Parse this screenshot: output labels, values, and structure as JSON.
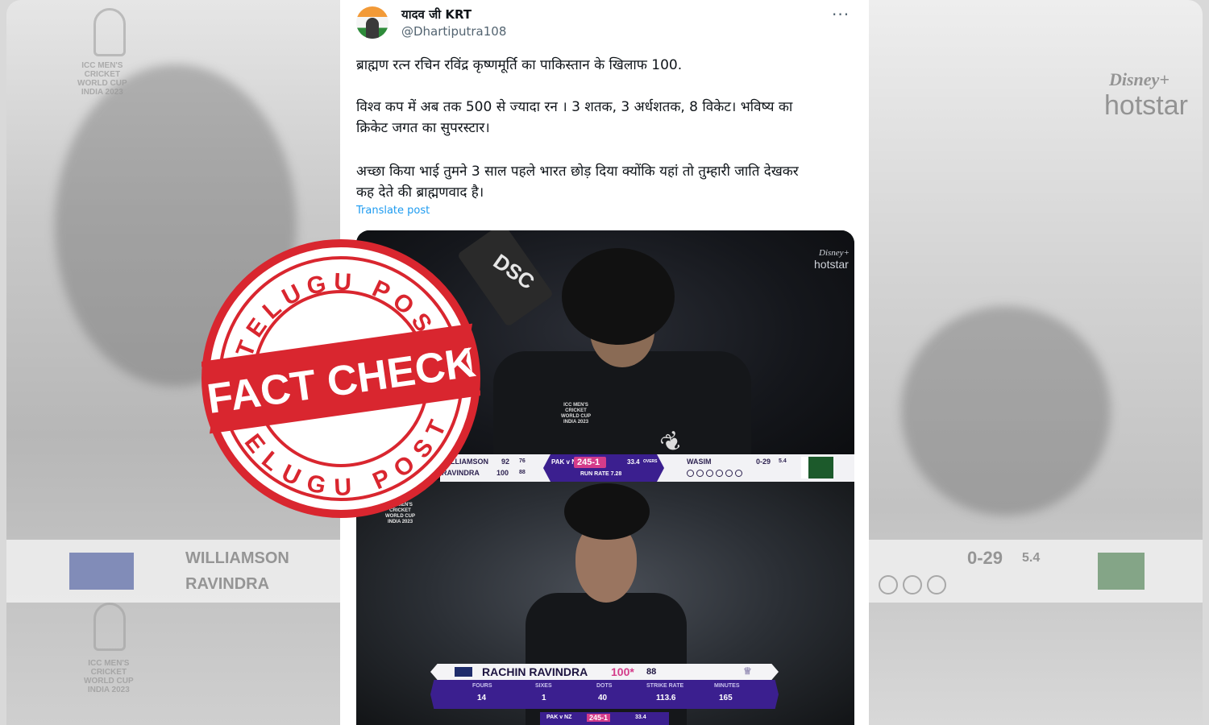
{
  "tweet": {
    "display_name": "यादव जी KRT",
    "handle": "@Dhartiputra108",
    "more_icon": "more-horizontal-icon",
    "lines": [
      "ब्राह्मण रत्न रचिन रविंद्र कृष्णमूर्ति का पाकिस्तान के खिलाफ 100.",
      "विश्व कप में अब तक 500 से ज्यादा रन । 3 शतक, 3 अर्धशतक, 8 विकेट। भविष्य का",
      "क्रिकेट जगत का सुपरस्टार।",
      "अच्छा किया भाई तुमने 3 साल पहले भारत छोड़ दिया क्योंकि यहां तो तुम्हारी जाति देखकर",
      "कह देते की ब्राह्मणवाद है।"
    ],
    "translate_label": "Translate post"
  },
  "media": {
    "broadcaster_top": "Disney+",
    "broadcaster": "hotstar",
    "bat_brand": "DSC",
    "event_logo": [
      "ICC MEN'S",
      "CRICKET",
      "WORLD CUP",
      "INDIA 2023"
    ],
    "scoreboard": {
      "batter1_name": "WILLIAMSON",
      "batter1_runs": "92",
      "batter1_balls": "76",
      "batter2_name": "RAVINDRA",
      "batter2_runs": "100",
      "batter2_balls": "88",
      "match": "PAK v NZ",
      "score": "245-1",
      "overs": "33.4",
      "overs_label": "OVERS",
      "run_rate": "RUN RATE 7.28",
      "bowler": "WASIM",
      "bowler_figures": "0-29",
      "bowler_overs": "5.4"
    },
    "player_card": {
      "name": "RACHIN RAVINDRA",
      "score": "100*",
      "balls": "88",
      "stats": [
        {
          "label": "FOURS",
          "value": "14"
        },
        {
          "label": "SIXES",
          "value": "1"
        },
        {
          "label": "DOTS",
          "value": "40"
        },
        {
          "label": "STRIKE RATE",
          "value": "113.6"
        },
        {
          "label": "MINUTES",
          "value": "165"
        }
      ]
    }
  },
  "background": {
    "batter1": "WILLIAMSON",
    "batter2": "RAVINDRA",
    "bowler_figures": "0-29",
    "bowler_overs": "5.4",
    "broadcaster_top": "Disney+",
    "broadcaster": "hotstar"
  },
  "stamp": {
    "top_text": "TELUGU POST",
    "bottom_text": "TELUGU POST",
    "banner": "FACT CHECK",
    "color": "#d9262f"
  }
}
